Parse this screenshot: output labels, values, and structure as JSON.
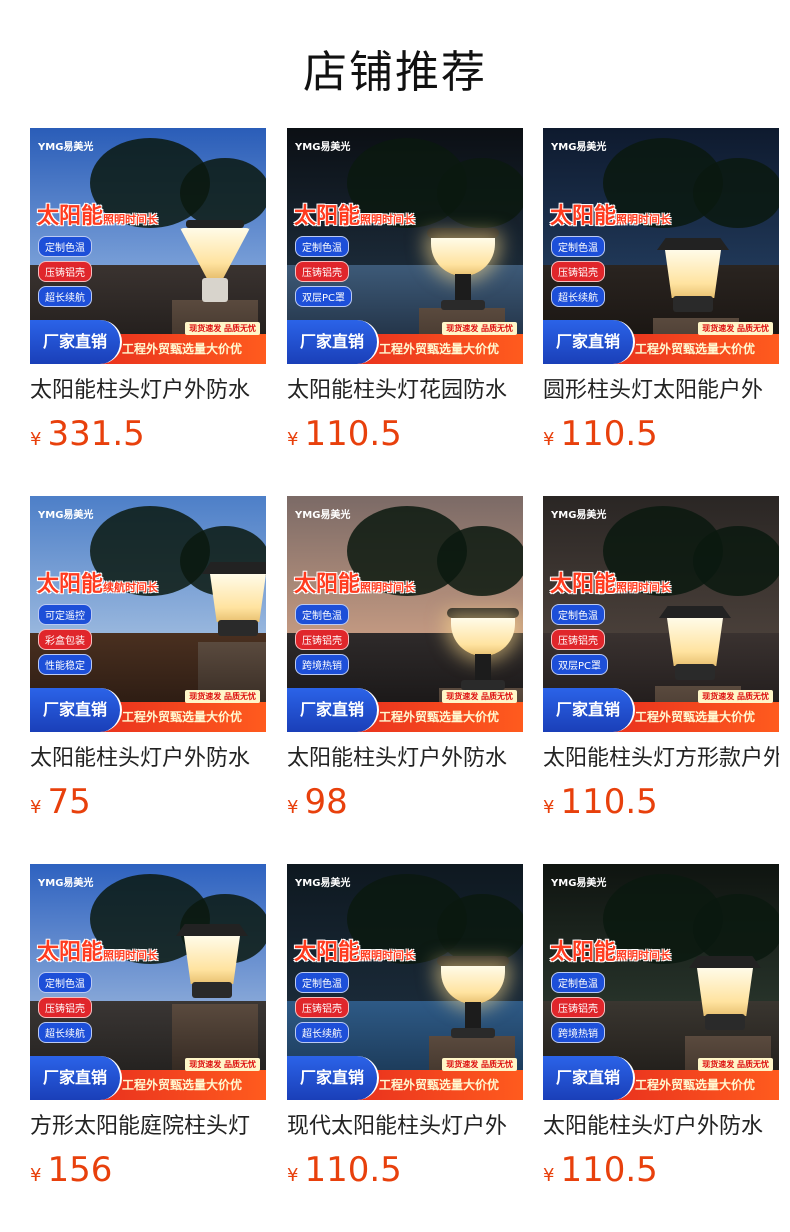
{
  "page": {
    "title": "店铺推荐"
  },
  "colors": {
    "price": "#e8400c",
    "badge_blue": "#1d4fd8",
    "badge_red": "#e0262b"
  },
  "products": [
    {
      "name": "太阳能柱头灯户外防水",
      "currency": "¥",
      "price": "331.5",
      "logo": "YMG易美光",
      "headline": "太阳能",
      "headline_sub": "照明时间长",
      "features": [
        "定制色温",
        "压铸铝壳",
        "超长续航"
      ],
      "badge": "厂家直销",
      "slogan": "工程外贸甄选量大价优",
      "stock_tag": "现货速发 品质无忧"
    },
    {
      "name": "太阳能柱头灯花园防水",
      "currency": "¥",
      "price": "110.5",
      "logo": "YMG易美光",
      "headline": "太阳能",
      "headline_sub": "照明时间长",
      "features": [
        "定制色温",
        "压铸铝壳",
        "双层PC罩"
      ],
      "badge": "厂家直销",
      "slogan": "工程外贸甄选量大价优",
      "stock_tag": "现货速发 品质无忧"
    },
    {
      "name": "圆形柱头灯太阳能户外",
      "currency": "¥",
      "price": "110.5",
      "logo": "YMG易美光",
      "headline": "太阳能",
      "headline_sub": "照明时间长",
      "features": [
        "定制色温",
        "压铸铝壳",
        "超长续航"
      ],
      "badge": "厂家直销",
      "slogan": "工程外贸甄选量大价优",
      "stock_tag": "现货速发 品质无忧"
    },
    {
      "name": "太阳能柱头灯户外防水",
      "currency": "¥",
      "price": "75",
      "logo": "YMG易美光",
      "headline": "太阳能",
      "headline_sub": "续航时间长",
      "features": [
        "可定遥控",
        "彩盒包装",
        "性能稳定"
      ],
      "badge": "厂家直销",
      "slogan": "工程外贸甄选量大价优",
      "stock_tag": "现货速发 品质无忧"
    },
    {
      "name": "太阳能柱头灯户外防水",
      "currency": "¥",
      "price": "98",
      "logo": "YMG易美光",
      "headline": "太阳能",
      "headline_sub": "照明时间长",
      "features": [
        "定制色温",
        "压铸铝壳",
        "跨境热销"
      ],
      "badge": "厂家直销",
      "slogan": "工程外贸甄选量大价优",
      "stock_tag": "现货速发 品质无忧"
    },
    {
      "name": "太阳能柱头灯方形款户外",
      "currency": "¥",
      "price": "110.5",
      "logo": "YMG易美光",
      "headline": "太阳能",
      "headline_sub": "照明时间长",
      "features": [
        "定制色温",
        "压铸铝壳",
        "双层PC罩"
      ],
      "badge": "厂家直销",
      "slogan": "工程外贸甄选量大价优",
      "stock_tag": "现货速发 品质无忧"
    },
    {
      "name": "方形太阳能庭院柱头灯",
      "currency": "¥",
      "price": "156",
      "logo": "YMG易美光",
      "headline": "太阳能",
      "headline_sub": "照明时间长",
      "features": [
        "定制色温",
        "压铸铝壳",
        "超长续航"
      ],
      "badge": "厂家直销",
      "slogan": "工程外贸甄选量大价优",
      "stock_tag": "现货速发 品质无忧"
    },
    {
      "name": "现代太阳能柱头灯户外",
      "currency": "¥",
      "price": "110.5",
      "logo": "YMG易美光",
      "headline": "太阳能",
      "headline_sub": "照明时间长",
      "features": [
        "定制色温",
        "压铸铝壳",
        "超长续航"
      ],
      "badge": "厂家直销",
      "slogan": "工程外贸甄选量大价优",
      "stock_tag": "现货速发 品质无忧"
    },
    {
      "name": "太阳能柱头灯户外防水",
      "currency": "¥",
      "price": "110.5",
      "logo": "YMG易美光",
      "headline": "太阳能",
      "headline_sub": "照明时间长",
      "features": [
        "定制色温",
        "压铸铝壳",
        "跨境热销"
      ],
      "badge": "厂家直销",
      "slogan": "工程外贸甄选量大价优",
      "stock_tag": "现货速发 品质无忧"
    }
  ]
}
